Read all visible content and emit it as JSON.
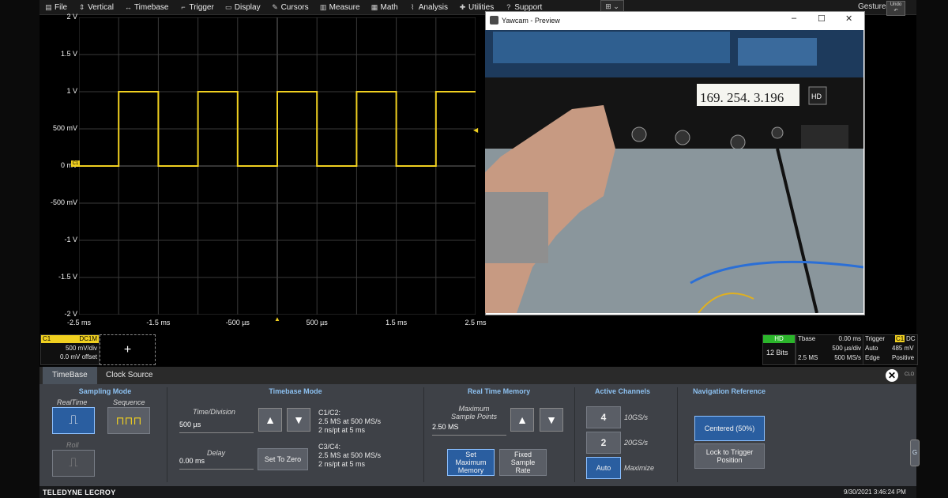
{
  "menu": [
    {
      "icon": "file-icon",
      "glyph": "▤",
      "label": "File"
    },
    {
      "icon": "vertical-icon",
      "glyph": "⇕",
      "label": "Vertical"
    },
    {
      "icon": "timebase-icon",
      "glyph": "↔",
      "label": "Timebase"
    },
    {
      "icon": "trigger-icon",
      "glyph": "⌐",
      "label": "Trigger"
    },
    {
      "icon": "display-icon",
      "glyph": "▭",
      "label": "Display"
    },
    {
      "icon": "cursors-icon",
      "glyph": "✎",
      "label": "Cursors"
    },
    {
      "icon": "measure-icon",
      "glyph": "▥",
      "label": "Measure"
    },
    {
      "icon": "math-icon",
      "glyph": "▦",
      "label": "Math"
    },
    {
      "icon": "analysis-icon",
      "glyph": "⌇",
      "label": "Analysis"
    },
    {
      "icon": "utilities-icon",
      "glyph": "✚",
      "label": "Utilities"
    },
    {
      "icon": "support-icon",
      "glyph": "?",
      "label": "Support"
    }
  ],
  "gesture": "Gesture",
  "undo_label": "Undo",
  "waveform": {
    "y_labels": [
      "2 V",
      "1.5 V",
      "1 V",
      "500 mV",
      "0 mV",
      "-500 mV",
      "-1 V",
      "-1.5 V",
      "-2 V"
    ],
    "x_labels": [
      "-2.5 ms",
      "-1.5 ms",
      "-500 µs",
      "500 µs",
      "1.5 ms",
      "2.5 ms"
    ],
    "marker": "C1",
    "trace_color": "#f0d020",
    "trace": {
      "low_v": 0,
      "high_v": 1,
      "period_ms": 1,
      "high_ms": 0.5,
      "first_rise_ms": -2,
      "x_range_ms": [
        -2.5,
        2.5
      ],
      "y_range_v": [
        -2,
        2
      ]
    }
  },
  "yawcam": {
    "title": "Yawcam - Preview",
    "minimize": "–",
    "maximize": "☐",
    "close": "✕",
    "ip_note": "169. 254. 3.196"
  },
  "c1": {
    "name": "C1",
    "coupling": "DC1M",
    "volts_div": "500 mV/div",
    "offset": "0.0 mV offset",
    "color": "#f0d020"
  },
  "add_channel": "+",
  "hd": {
    "label": "HD",
    "bits": "12 Bits",
    "color": "#2bb52b"
  },
  "tbase": {
    "label": "Tbase",
    "delay": "0.00 ms",
    "time_div": "500 µs/div",
    "samples": "2.5 MS",
    "rate": "500 MS/s"
  },
  "trigger": {
    "label": "Trigger",
    "channel": "C1",
    "coupling": "DC",
    "mode": "Auto",
    "level": "485 mV",
    "type": "Edge",
    "slope": "Positive"
  },
  "tabs": {
    "timebase": "TimeBase",
    "clock": "Clock Source"
  },
  "close_label": "CLO",
  "sampling": {
    "title": "Sampling Mode",
    "realtime": "RealTime",
    "sequence": "Sequence",
    "roll": "Roll"
  },
  "timebase_mode": {
    "title": "Timebase Mode",
    "time_div_label": "Time/Division",
    "time_div_value": "500 µs",
    "delay_label": "Delay",
    "delay_value": "0.00 ms",
    "set_zero": "Set To Zero",
    "c12_label": "C1/C2:",
    "c12_rate": "2.5 MS at 500 MS/s",
    "c12_res": "2 ns/pt at 5 ms",
    "c34_label": "C3/C4:",
    "c34_rate": "2.5 MS at 500 MS/s",
    "c34_res": "2 ns/pt at 5 ms"
  },
  "memory": {
    "title": "Real Time Memory",
    "max_points_label": "Maximum\nSample Points",
    "max_points_value": "2.50 MS",
    "set_max": "Set\nMaximum\nMemory",
    "fixed_rate": "Fixed\nSample\nRate"
  },
  "channels": {
    "title": "Active Channels",
    "four": "4",
    "four_rate": "10GS/s",
    "two": "2",
    "two_rate": "20GS/s",
    "auto": "Auto",
    "auto_label": "Maximize"
  },
  "navigation": {
    "title": "Navigation Reference",
    "centered": "Centered (50%)",
    "lock": "Lock to Trigger\nPosition"
  },
  "brand": "TELEDYNE LECROY",
  "datetime": "9/30/2021 3:46:24 PM",
  "colors": {
    "accent": "#2a5ea0",
    "section_title": "#8cc0f0",
    "panel": "#3e4147"
  }
}
